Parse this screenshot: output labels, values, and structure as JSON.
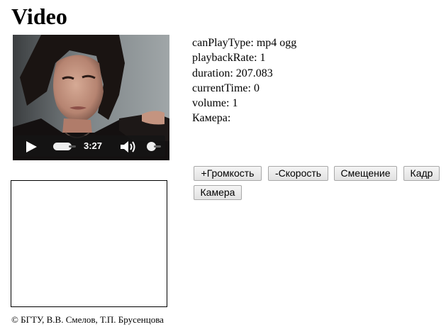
{
  "page": {
    "title": "Video"
  },
  "video": {
    "time": "3:27",
    "played_fraction": 0.0,
    "volume_fraction": 1.0
  },
  "info": {
    "lines": [
      "canPlayType: mp4 ogg",
      "playbackRate: 1",
      "duration: 207.083",
      "currentTime: 0",
      "volume: 1",
      "Камера:"
    ]
  },
  "buttons": [
    "+Громкость",
    "-Скорость",
    "Смещение",
    "Кадр",
    "Камера"
  ],
  "footer": {
    "text": "© БГТУ, В.В. Смелов, Т.П. Брусенцова"
  },
  "icons": {
    "play": "play-icon",
    "speaker": "speaker-icon"
  }
}
